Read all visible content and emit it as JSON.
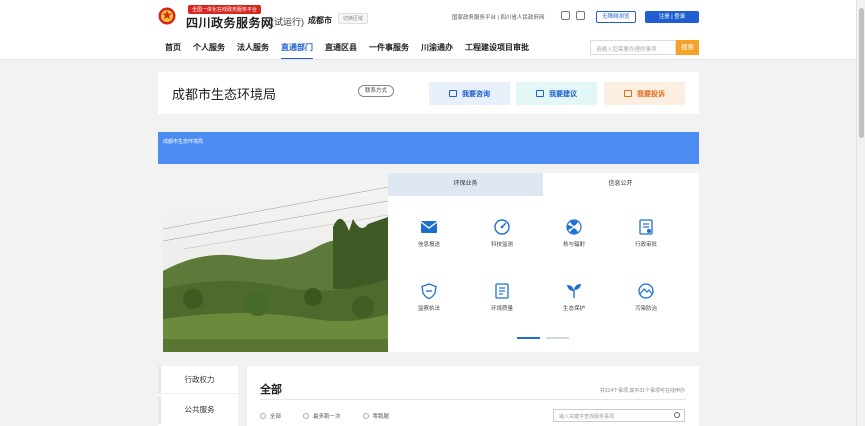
{
  "header": {
    "slogan": "全国一体化在线政务服务平台",
    "site_name": "四川政务服务网",
    "trial": "(试运行)",
    "city": "成都市",
    "switch_area": "切换区域",
    "links": "国家政务服务平台 | 四川省人民政府网",
    "accessibility": "无障碍浏览",
    "auth": "注册 | 登录",
    "search_placeholder": "请输入您需要办理的事项",
    "search_button": "搜索"
  },
  "nav": [
    {
      "label": "首页"
    },
    {
      "label": "个人服务"
    },
    {
      "label": "法人服务"
    },
    {
      "label": "直通部门",
      "active": true
    },
    {
      "label": "直通区县"
    },
    {
      "label": "一件事服务"
    },
    {
      "label": "川渝通办"
    },
    {
      "label": "工程建设项目审批"
    }
  ],
  "dept": {
    "title": "成都市生态环境局",
    "contact": "联系方式",
    "actions": [
      "我要咨询",
      "我要建议",
      "我要投诉"
    ]
  },
  "banner": {
    "text": "成都市生态环境局"
  },
  "tabs": [
    "环保业务",
    "信息公开"
  ],
  "services": [
    {
      "label": "信息报送",
      "icon": "envelope-icon"
    },
    {
      "label": "科技监测",
      "icon": "gauge-icon"
    },
    {
      "label": "核与辐射",
      "icon": "radiation-icon"
    },
    {
      "label": "行政审批",
      "icon": "document-icon"
    },
    {
      "label": "监察执法",
      "icon": "shield-icon"
    },
    {
      "label": "环境质量",
      "icon": "report-icon"
    },
    {
      "label": "生态保护",
      "icon": "sprout-icon"
    },
    {
      "label": "污染防治",
      "icon": "landscape-icon"
    }
  ],
  "sidebar": [
    "行政权力",
    "公共服务"
  ],
  "list": {
    "title": "全部",
    "stats": "共314个事项,其中31个事项可在线申办",
    "filters": [
      "全部",
      "最多跑一次",
      "零跑腿"
    ],
    "search_placeholder": "输入关键字查找服务事项"
  },
  "colors": {
    "primary": "#1f5fd1",
    "banner": "#4a8cf0",
    "search": "#f7a227",
    "complain": "#e06c1a"
  }
}
